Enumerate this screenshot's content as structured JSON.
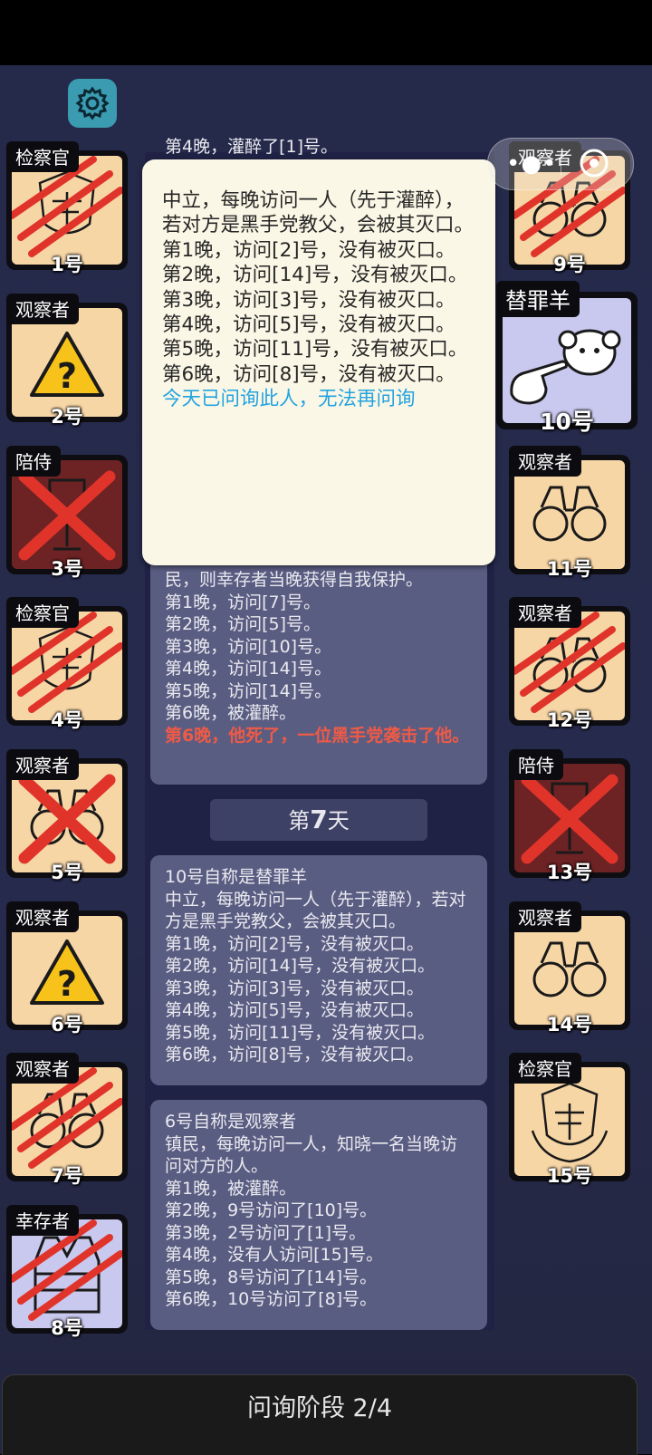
{
  "players": {
    "p1": {
      "role": "检察官",
      "num": "1号"
    },
    "p2": {
      "role": "观察者",
      "num": "2号"
    },
    "p3": {
      "role": "陪侍",
      "num": "3号"
    },
    "p4": {
      "role": "检察官",
      "num": "4号"
    },
    "p5": {
      "role": "观察者",
      "num": "5号"
    },
    "p6": {
      "role": "观察者",
      "num": "6号"
    },
    "p7": {
      "role": "观察者",
      "num": "7号"
    },
    "p8": {
      "role": "幸存者",
      "num": "8号"
    },
    "p9": {
      "role": "观察者",
      "num": "9号"
    },
    "p10": {
      "role": "替罪羊",
      "num": "10号"
    },
    "p11": {
      "role": "观察者",
      "num": "11号"
    },
    "p12": {
      "role": "观察者",
      "num": "12号"
    },
    "p13": {
      "role": "陪侍",
      "num": "13号"
    },
    "p14": {
      "role": "观察者",
      "num": "14号"
    },
    "p15": {
      "role": "检察官",
      "num": "15号"
    }
  },
  "log": {
    "top_peek": "第4晚，灌醉了[1]号。",
    "entry_a": [
      "民，则幸存者当晚获得自我保护。",
      "第1晚，访问[7]号。",
      "第2晚，访问[5]号。",
      "第3晚，访问[10]号。",
      "第4晚，访问[14]号。",
      "第5晚，访问[14]号。",
      "第6晚，被灌醉。"
    ],
    "entry_a_death": "第6晚，他死了，一位黑手党袭击了他。",
    "day_prefix": "第",
    "day_number": "7",
    "day_suffix": "天",
    "entry_b": [
      "10号自称是替罪羊",
      "中立，每晚访问一人（先于灌醉），若对方是黑手党教父，会被其灭口。",
      "第1晚，访问[2]号，没有被灭口。",
      "第2晚，访问[14]号，没有被灭口。",
      "第3晚，访问[3]号，没有被灭口。",
      "第4晚，访问[5]号，没有被灭口。",
      "第5晚，访问[11]号，没有被灭口。",
      "第6晚，访问[8]号，没有被灭口。"
    ],
    "entry_c": [
      "6号自称是观察者",
      "镇民，每晚访问一人，知晓一名当晚访问对方的人。",
      "第1晚，被灌醉。",
      "第2晚，9号访问了[10]号。",
      "第3晚，2号访问了[1]号。",
      "第4晚，没有人访问[15]号。",
      "第5晚，8号访问了[14]号。",
      "第6晚，10号访问了[8]号。"
    ]
  },
  "popup": {
    "lines": [
      "中立，每晚访问一人（先于灌醉），若对方是黑手党教父，会被其灭口。",
      "第1晚，访问[2]号，没有被灭口。",
      "第2晚，访问[14]号，没有被灭口。",
      "第3晚，访问[3]号，没有被灭口。",
      "第4晚，访问[5]号，没有被灭口。",
      "第5晚，访问[11]号，没有被灭口。",
      "第6晚，访问[8]号，没有被灭口。"
    ],
    "note": "今天已问询此人，无法再问询"
  },
  "footer": {
    "phase": "问询阶段 2/4"
  },
  "colors": {
    "slash_red": "#e0342b",
    "popup_note": "#23a3e0",
    "death_text": "#f05a45"
  },
  "icons": [
    "gear-icon",
    "more-dots-icon",
    "target-icon",
    "scales-badge-icon",
    "binoculars-icon",
    "question-warning-icon",
    "wine-glass-icon",
    "sheep-icon",
    "pointing-hand-icon",
    "vest-icon",
    "claw-slash-icon",
    "cross-icon"
  ]
}
